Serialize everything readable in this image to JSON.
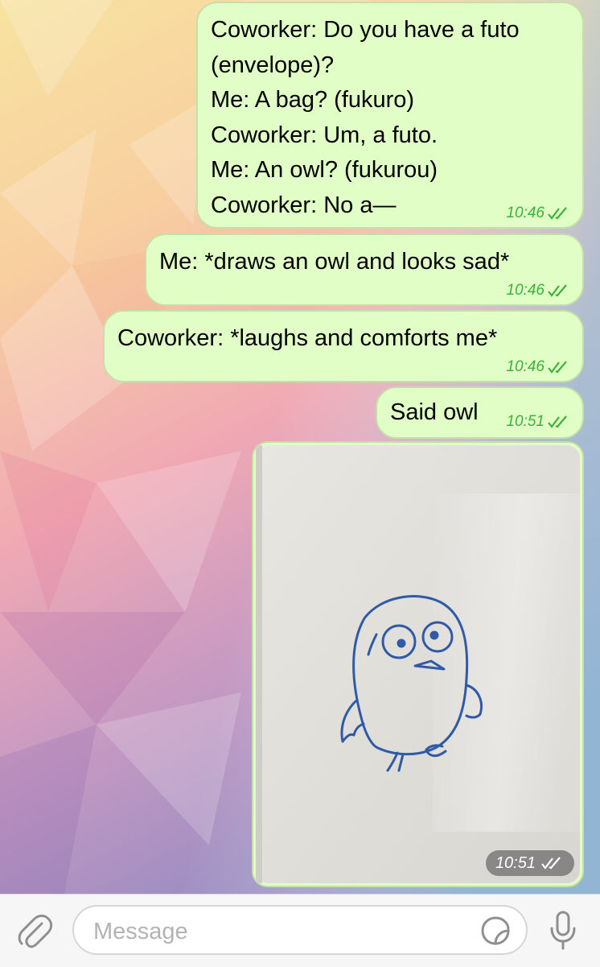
{
  "messages": [
    {
      "text": "Coworker: Do you have a futo\n(envelope)?\nMe: A bag? (fukuro)\nCoworker: Um, a futo.\nMe: An owl? (fukurou)\nCoworker: No a—",
      "time": "10:46",
      "status": "read"
    },
    {
      "text": "Me: *draws an owl and looks sad*",
      "time": "10:46",
      "status": "read"
    },
    {
      "text": "Coworker: *laughs and comforts me*",
      "time": "10:46",
      "status": "read"
    },
    {
      "text": "Said owl",
      "time": "10:51",
      "status": "read"
    }
  ],
  "photo_message": {
    "time": "10:51",
    "status": "read",
    "depicts": "owl-drawing-on-whiteboard"
  },
  "composer": {
    "placeholder": "Message",
    "value": ""
  },
  "icons": {
    "attach": "paperclip-icon",
    "sticker": "sticker-icon",
    "mic": "microphone-icon",
    "read_receipt": "double-check-icon"
  },
  "colors": {
    "outgoing_bubble": "#e1fec6",
    "outgoing_meta": "#3cb23a",
    "input_bar": "#f6f6f6",
    "icon_gray": "#8e8e93"
  }
}
